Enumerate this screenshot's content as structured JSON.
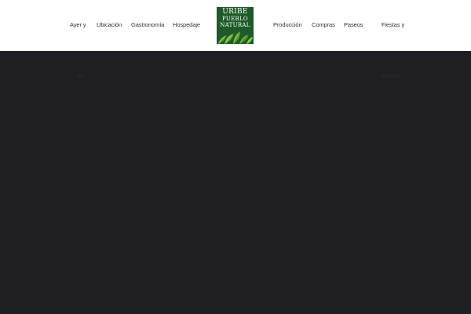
{
  "nav": {
    "left": [
      "Ayer y",
      "Ubicación",
      "Gastronomía",
      "Hospedaje"
    ],
    "right": [
      "Producción",
      "Compras",
      "Paseos",
      "Fiestas y"
    ]
  },
  "logo": {
    "line1": "URIBE",
    "line2": "PUEBLO",
    "line3": "NATURAL"
  },
  "hero": {
    "faint_left": "Ay",
    "faint_right": "Fiestas"
  },
  "colors": {
    "logo_green": "#1f5a2a",
    "leaf_green": "#7fbf3f",
    "hero_bg": "#1f1e23"
  }
}
